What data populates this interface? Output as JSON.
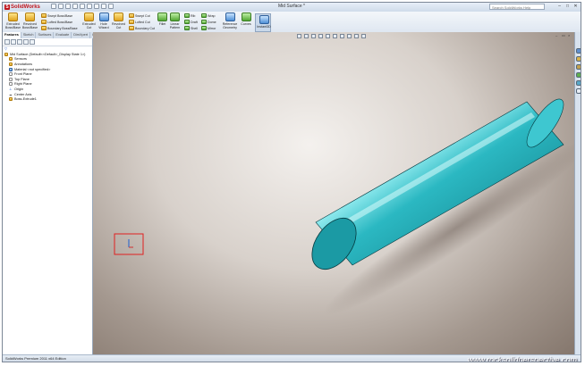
{
  "app": {
    "logo_text": "SolidWorks",
    "logo_mark": "S",
    "document_title": "Mid Surface *",
    "search_placeholder": "Search SolidWorks Help",
    "window_buttons": [
      "–",
      "□",
      "✕"
    ]
  },
  "commands": {
    "extruded_boss": "Extruded Boss/Base",
    "revolved_boss": "Revolved Boss/Base",
    "swept_boss": "Swept Boss/Base",
    "lofted_boss": "Lofted Boss/Base",
    "boundary_boss": "Boundary Boss/Base",
    "extruded_cut": "Extruded Cut",
    "hole_wizard": "Hole Wizard",
    "revolved_cut": "Revolved Cut",
    "swept_cut": "Swept Cut",
    "lofted_cut": "Lofted Cut",
    "boundary_cut": "Boundary Cut",
    "fillet": "Fillet",
    "linear_pattern": "Linear Pattern",
    "rib": "Rib",
    "draft": "Draft",
    "shell": "Shell",
    "wrap": "Wrap",
    "dome": "Dome",
    "mirror": "Mirror",
    "reference_geometry": "Reference Geometry",
    "curves": "Curves",
    "instant3d": "Instant3D"
  },
  "tabs": [
    "Features",
    "Sketch",
    "Surfaces",
    "Evaluate",
    "DimXpert",
    "Office Products"
  ],
  "tree": {
    "root": "Mid Surface  (Default<<Default>_Display State 1>)",
    "items": [
      "Sensors",
      "Annotations",
      "Material <not specified>",
      "Front Plane",
      "Top Plane",
      "Right Plane",
      "Origin",
      "Center Axis",
      "Boss-Extrude1"
    ]
  },
  "status": {
    "text": "SolidWorks Premium 2011 x64 Edition"
  },
  "watermark": "www.rocksolidperspective.com",
  "colors": {
    "cylinder": "#1fa3ad",
    "highlight_box": "#e02020",
    "triad_y": "#1f5fcf",
    "triad_x": "#d03030"
  }
}
